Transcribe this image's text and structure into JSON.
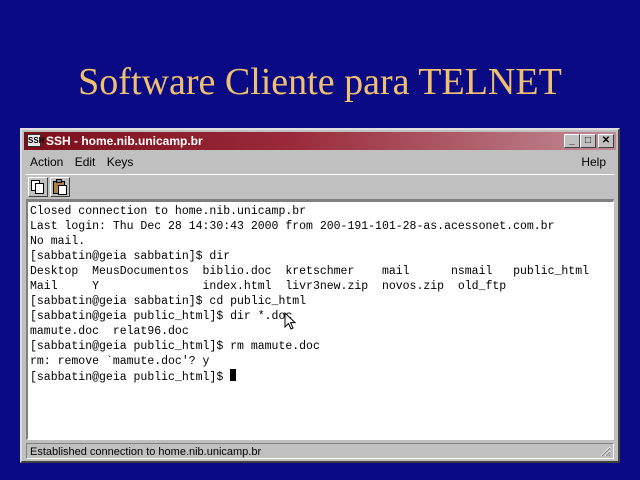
{
  "slide": {
    "title": "Software Cliente para TELNET"
  },
  "window": {
    "title": "SSH - home.nib.unicamp.br",
    "app_icon_text": "SSH",
    "buttons": {
      "minimize": "_",
      "maximize": "□",
      "close": "✕"
    }
  },
  "menu": {
    "action": "Action",
    "edit": "Edit",
    "keys": "Keys",
    "help": "Help"
  },
  "toolbar": {
    "copy_icon": "copy-icon",
    "paste_icon": "paste-icon"
  },
  "terminal": {
    "lines": [
      "Closed connection to home.nib.unicamp.br",
      "Last login: Thu Dec 28 14:30:43 2000 from 200-191-101-28-as.acessonet.com.br",
      "No mail.",
      "[sabbatin@geia sabbatin]$ dir",
      "Desktop  MeusDocumentos  biblio.doc  kretschmer    mail      nsmail   public_html",
      "Mail     Y               index.html  livr3new.zip  novos.zip  old_ftp",
      "[sabbatin@geia sabbatin]$ cd public_html",
      "[sabbatin@geia public_html]$ dir *.doc",
      "mamute.doc  relat96.doc",
      "[sabbatin@geia public_html]$ rm mamute.doc",
      "rm: remove `mamute.doc'? y",
      "[sabbatin@geia public_html]$ "
    ]
  },
  "status": {
    "text": "Established connection to home.nib.unicamp.br"
  }
}
